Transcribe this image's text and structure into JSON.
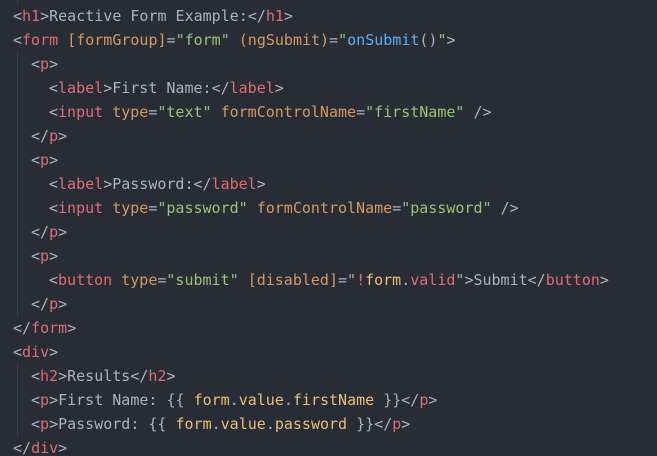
{
  "editor": {
    "lines": [
      {
        "indent": 0,
        "tokens": [
          {
            "t": "bracket",
            "v": "<"
          },
          {
            "t": "tag",
            "v": "h1"
          },
          {
            "t": "bracket",
            "v": ">"
          },
          {
            "t": "text",
            "v": "Reactive Form Example:"
          },
          {
            "t": "bracket",
            "v": "</"
          },
          {
            "t": "tag",
            "v": "h1"
          },
          {
            "t": "bracket",
            "v": ">"
          }
        ]
      },
      {
        "indent": 0,
        "tokens": [
          {
            "t": "bracket",
            "v": "<"
          },
          {
            "t": "tag",
            "v": "form"
          },
          {
            "t": "text",
            "v": " "
          },
          {
            "t": "attr",
            "v": "[formGroup]"
          },
          {
            "t": "text",
            "v": "="
          },
          {
            "t": "string",
            "v": "\"form\""
          },
          {
            "t": "text",
            "v": " "
          },
          {
            "t": "attr",
            "v": "(ngSubmit)"
          },
          {
            "t": "text",
            "v": "="
          },
          {
            "t": "string",
            "v": "\""
          },
          {
            "t": "func",
            "v": "onSubmit"
          },
          {
            "t": "text",
            "v": "()"
          },
          {
            "t": "string",
            "v": "\""
          },
          {
            "t": "bracket",
            "v": ">"
          }
        ]
      },
      {
        "indent": 1,
        "tokens": [
          {
            "t": "bracket",
            "v": "<"
          },
          {
            "t": "tag",
            "v": "p"
          },
          {
            "t": "bracket",
            "v": ">"
          }
        ]
      },
      {
        "indent": 2,
        "tokens": [
          {
            "t": "bracket",
            "v": "<"
          },
          {
            "t": "tag",
            "v": "label"
          },
          {
            "t": "bracket",
            "v": ">"
          },
          {
            "t": "text",
            "v": "First Name:"
          },
          {
            "t": "bracket",
            "v": "</"
          },
          {
            "t": "tag",
            "v": "label"
          },
          {
            "t": "bracket",
            "v": ">"
          }
        ]
      },
      {
        "indent": 2,
        "tokens": [
          {
            "t": "bracket",
            "v": "<"
          },
          {
            "t": "tag",
            "v": "input"
          },
          {
            "t": "text",
            "v": " "
          },
          {
            "t": "attr",
            "v": "type"
          },
          {
            "t": "text",
            "v": "="
          },
          {
            "t": "string",
            "v": "\"text\""
          },
          {
            "t": "text",
            "v": " "
          },
          {
            "t": "attr",
            "v": "formControlName"
          },
          {
            "t": "text",
            "v": "="
          },
          {
            "t": "string",
            "v": "\"firstName\""
          },
          {
            "t": "text",
            "v": " "
          },
          {
            "t": "bracket",
            "v": "/>"
          }
        ]
      },
      {
        "indent": 1,
        "tokens": [
          {
            "t": "bracket",
            "v": "</"
          },
          {
            "t": "tag",
            "v": "p"
          },
          {
            "t": "bracket",
            "v": ">"
          }
        ]
      },
      {
        "indent": 1,
        "tokens": [
          {
            "t": "bracket",
            "v": "<"
          },
          {
            "t": "tag",
            "v": "p"
          },
          {
            "t": "bracket",
            "v": ">"
          }
        ]
      },
      {
        "indent": 2,
        "tokens": [
          {
            "t": "bracket",
            "v": "<"
          },
          {
            "t": "tag",
            "v": "label"
          },
          {
            "t": "bracket",
            "v": ">"
          },
          {
            "t": "text",
            "v": "Password:"
          },
          {
            "t": "bracket",
            "v": "</"
          },
          {
            "t": "tag",
            "v": "label"
          },
          {
            "t": "bracket",
            "v": ">"
          }
        ]
      },
      {
        "indent": 2,
        "tokens": [
          {
            "t": "bracket",
            "v": "<"
          },
          {
            "t": "tag",
            "v": "input"
          },
          {
            "t": "text",
            "v": " "
          },
          {
            "t": "attr",
            "v": "type"
          },
          {
            "t": "text",
            "v": "="
          },
          {
            "t": "string",
            "v": "\"password\""
          },
          {
            "t": "text",
            "v": " "
          },
          {
            "t": "attr",
            "v": "formControlName"
          },
          {
            "t": "text",
            "v": "="
          },
          {
            "t": "string",
            "v": "\"password\""
          },
          {
            "t": "text",
            "v": " "
          },
          {
            "t": "bracket",
            "v": "/>"
          }
        ]
      },
      {
        "indent": 1,
        "tokens": [
          {
            "t": "bracket",
            "v": "</"
          },
          {
            "t": "tag",
            "v": "p"
          },
          {
            "t": "bracket",
            "v": ">"
          }
        ]
      },
      {
        "indent": 1,
        "tokens": [
          {
            "t": "bracket",
            "v": "<"
          },
          {
            "t": "tag",
            "v": "p"
          },
          {
            "t": "bracket",
            "v": ">"
          }
        ]
      },
      {
        "indent": 2,
        "tokens": [
          {
            "t": "bracket",
            "v": "<"
          },
          {
            "t": "tag",
            "v": "button"
          },
          {
            "t": "text",
            "v": " "
          },
          {
            "t": "attr",
            "v": "type"
          },
          {
            "t": "text",
            "v": "="
          },
          {
            "t": "string",
            "v": "\"submit\""
          },
          {
            "t": "text",
            "v": " "
          },
          {
            "t": "attr",
            "v": "[disabled]"
          },
          {
            "t": "text",
            "v": "="
          },
          {
            "t": "string",
            "v": "\""
          },
          {
            "t": "tag",
            "v": "!"
          },
          {
            "t": "var",
            "v": "form"
          },
          {
            "t": "text",
            "v": "."
          },
          {
            "t": "prop",
            "v": "valid"
          },
          {
            "t": "string",
            "v": "\""
          },
          {
            "t": "bracket",
            "v": ">"
          },
          {
            "t": "text",
            "v": "Submit"
          },
          {
            "t": "bracket",
            "v": "</"
          },
          {
            "t": "tag",
            "v": "button"
          },
          {
            "t": "bracket",
            "v": ">"
          }
        ]
      },
      {
        "indent": 1,
        "tokens": [
          {
            "t": "bracket",
            "v": "</"
          },
          {
            "t": "tag",
            "v": "p"
          },
          {
            "t": "bracket",
            "v": ">"
          }
        ]
      },
      {
        "indent": 0,
        "tokens": [
          {
            "t": "bracket",
            "v": "</"
          },
          {
            "t": "tag",
            "v": "form"
          },
          {
            "t": "bracket",
            "v": ">"
          }
        ]
      },
      {
        "indent": 0,
        "tokens": [
          {
            "t": "bracket",
            "v": "<"
          },
          {
            "t": "tag",
            "v": "div"
          },
          {
            "t": "bracket",
            "v": ">"
          }
        ]
      },
      {
        "indent": 1,
        "tokens": [
          {
            "t": "bracket",
            "v": "<"
          },
          {
            "t": "tag",
            "v": "h2"
          },
          {
            "t": "bracket",
            "v": ">"
          },
          {
            "t": "text",
            "v": "Results"
          },
          {
            "t": "bracket",
            "v": "</"
          },
          {
            "t": "tag",
            "v": "h2"
          },
          {
            "t": "bracket",
            "v": ">"
          }
        ]
      },
      {
        "indent": 1,
        "tokens": [
          {
            "t": "bracket",
            "v": "<"
          },
          {
            "t": "tag",
            "v": "p"
          },
          {
            "t": "bracket",
            "v": ">"
          },
          {
            "t": "text",
            "v": "First Name: {{ "
          },
          {
            "t": "var",
            "v": "form"
          },
          {
            "t": "text",
            "v": "."
          },
          {
            "t": "var",
            "v": "value"
          },
          {
            "t": "text",
            "v": "."
          },
          {
            "t": "var",
            "v": "firstName"
          },
          {
            "t": "text",
            "v": " }}"
          },
          {
            "t": "bracket",
            "v": "</"
          },
          {
            "t": "tag",
            "v": "p"
          },
          {
            "t": "bracket",
            "v": ">"
          }
        ]
      },
      {
        "indent": 1,
        "tokens": [
          {
            "t": "bracket",
            "v": "<"
          },
          {
            "t": "tag",
            "v": "p"
          },
          {
            "t": "bracket",
            "v": ">"
          },
          {
            "t": "text",
            "v": "Password: {{ "
          },
          {
            "t": "var",
            "v": "form"
          },
          {
            "t": "text",
            "v": "."
          },
          {
            "t": "var",
            "v": "value"
          },
          {
            "t": "text",
            "v": "."
          },
          {
            "t": "var",
            "v": "password"
          },
          {
            "t": "text",
            "v": " }}"
          },
          {
            "t": "bracket",
            "v": "</"
          },
          {
            "t": "tag",
            "v": "p"
          },
          {
            "t": "bracket",
            "v": ">"
          }
        ]
      },
      {
        "indent": 0,
        "tokens": [
          {
            "t": "bracket",
            "v": "</"
          },
          {
            "t": "tag",
            "v": "div"
          },
          {
            "t": "bracket",
            "v": ">"
          }
        ]
      }
    ]
  },
  "colors": {
    "background": "#282c34",
    "tag": "#e06c75",
    "attribute": "#d19a66",
    "string": "#98c379",
    "function": "#61afef",
    "variable": "#e5c07b",
    "text": "#abb2bf"
  }
}
